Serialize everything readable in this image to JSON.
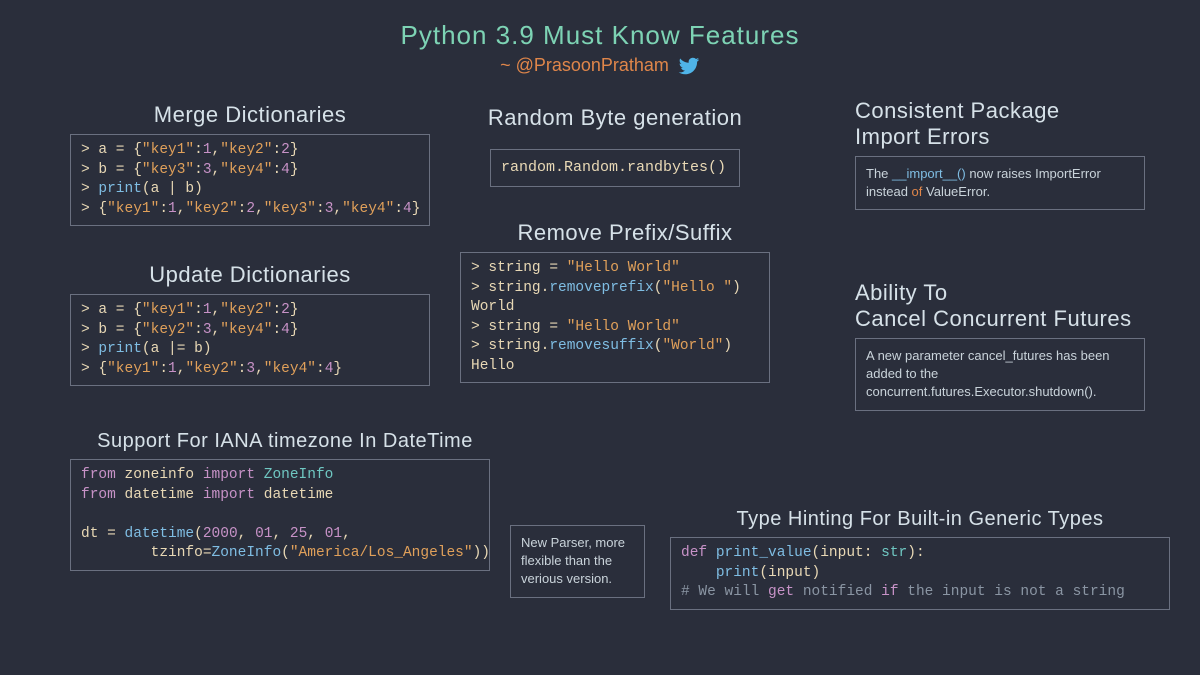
{
  "title": "Python 3.9 Must Know Features",
  "author": "~ @PrasoonPratham",
  "sections": {
    "merge": {
      "title": "Merge Dictionaries"
    },
    "update": {
      "title": "Update Dictionaries"
    },
    "iana": {
      "title": "Support For IANA timezone In DateTime"
    },
    "random": {
      "title": "Random Byte generation",
      "code": "random.Random.randbytes()"
    },
    "remove": {
      "title": "Remove Prefix/Suffix"
    },
    "importerr": {
      "title": "Consistent Package\nImport Errors",
      "t1": "The ",
      "t2": "__import__()",
      "t3": " now raises ",
      "t4": "ImportError",
      "t5": " instead ",
      "t6": "of",
      "t7": " ValueError."
    },
    "cancel": {
      "title": "Ability To\nCancel Concurrent Futures",
      "text": "A new parameter cancel_futures has been added to the concurrent.futures.Executor.shutdown()."
    },
    "typing": {
      "title": "Type Hinting For Built-in Generic Types"
    },
    "parser": {
      "text": "New Parser, more flexible than the verious version."
    }
  },
  "code": {
    "merge": {
      "l1a": "> a = {",
      "l1b": "\"key1\"",
      "l1c": ":",
      "l1d": "1",
      "l1e": ",",
      "l1f": "\"key2\"",
      "l1g": ":",
      "l1h": "2",
      "l1i": "}",
      "l2a": "> b = {",
      "l2b": "\"key3\"",
      "l2c": ":",
      "l2d": "3",
      "l2e": ",",
      "l2f": "\"key4\"",
      "l2g": ":",
      "l2h": "4",
      "l2i": "}",
      "l3a": "> ",
      "l3b": "print",
      "l3c": "(a | b)",
      "l4a": "> {",
      "l4b": "\"key1\"",
      "l4c": ":",
      "l4d": "1",
      "l4e": ",",
      "l4f": "\"key2\"",
      "l4g": ":",
      "l4h": "2",
      "l4i": ",",
      "l4j": "\"key3\"",
      "l4k": ":",
      "l4l": "3",
      "l4m": ",",
      "l4n": "\"key4\"",
      "l4o": ":",
      "l4p": "4",
      "l4q": "}"
    },
    "update": {
      "l1a": "> a = {",
      "l1b": "\"key1\"",
      "l1c": ":",
      "l1d": "1",
      "l1e": ",",
      "l1f": "\"key2\"",
      "l1g": ":",
      "l1h": "2",
      "l1i": "}",
      "l2a": "> b = {",
      "l2b": "\"key2\"",
      "l2c": ":",
      "l2d": "3",
      "l2e": ",",
      "l2f": "\"key4\"",
      "l2g": ":",
      "l2h": "4",
      "l2i": "}",
      "l3a": "> ",
      "l3b": "print",
      "l3c": "(a |= b)",
      "l4a": "> {",
      "l4b": "\"key1\"",
      "l4c": ":",
      "l4d": "1",
      "l4e": ",",
      "l4f": "\"key2\"",
      "l4g": ":",
      "l4h": "3",
      "l4i": ",",
      "l4j": "\"key4\"",
      "l4k": ":",
      "l4l": "4",
      "l4m": "}"
    },
    "iana": {
      "l1a": "from",
      "l1b": " zoneinfo ",
      "l1c": "import",
      "l1d": " ZoneInfo",
      "l2a": "from",
      "l2b": " datetime ",
      "l2c": "import",
      "l2d": " datetime",
      "l3": "",
      "l4a": "dt = ",
      "l4b": "datetime",
      "l4c": "(",
      "l4d": "2000",
      "l4e": ", ",
      "l4f": "01",
      "l4g": ", ",
      "l4h": "25",
      "l4i": ", ",
      "l4j": "01",
      "l4k": ",",
      "l5a": "        tzinfo=",
      "l5b": "ZoneInfo",
      "l5c": "(",
      "l5d": "\"America/Los_Angeles\"",
      "l5e": "))"
    },
    "remove": {
      "l1a": "> string = ",
      "l1b": "\"Hello World\"",
      "l2a": "> string.",
      "l2b": "removeprefix",
      "l2c": "(",
      "l2d": "\"Hello \"",
      "l2e": ")",
      "l3": "World",
      "l4a": "> string = ",
      "l4b": "\"Hello World\"",
      "l5a": "> string.",
      "l5b": "removesuffix",
      "l5c": "(",
      "l5d": "\"World\"",
      "l5e": ")",
      "l6": "Hello"
    },
    "typing": {
      "l1a": "def",
      "l1b": " ",
      "l1c": "print_value",
      "l1d": "(input: ",
      "l1e": "str",
      "l1f": "):",
      "l2a": "    ",
      "l2b": "print",
      "l2c": "(input)",
      "l3a": "# We will ",
      "l3b": "get",
      "l3c": " notified ",
      "l3d": "if",
      "l3e": " the input is not a string"
    }
  }
}
